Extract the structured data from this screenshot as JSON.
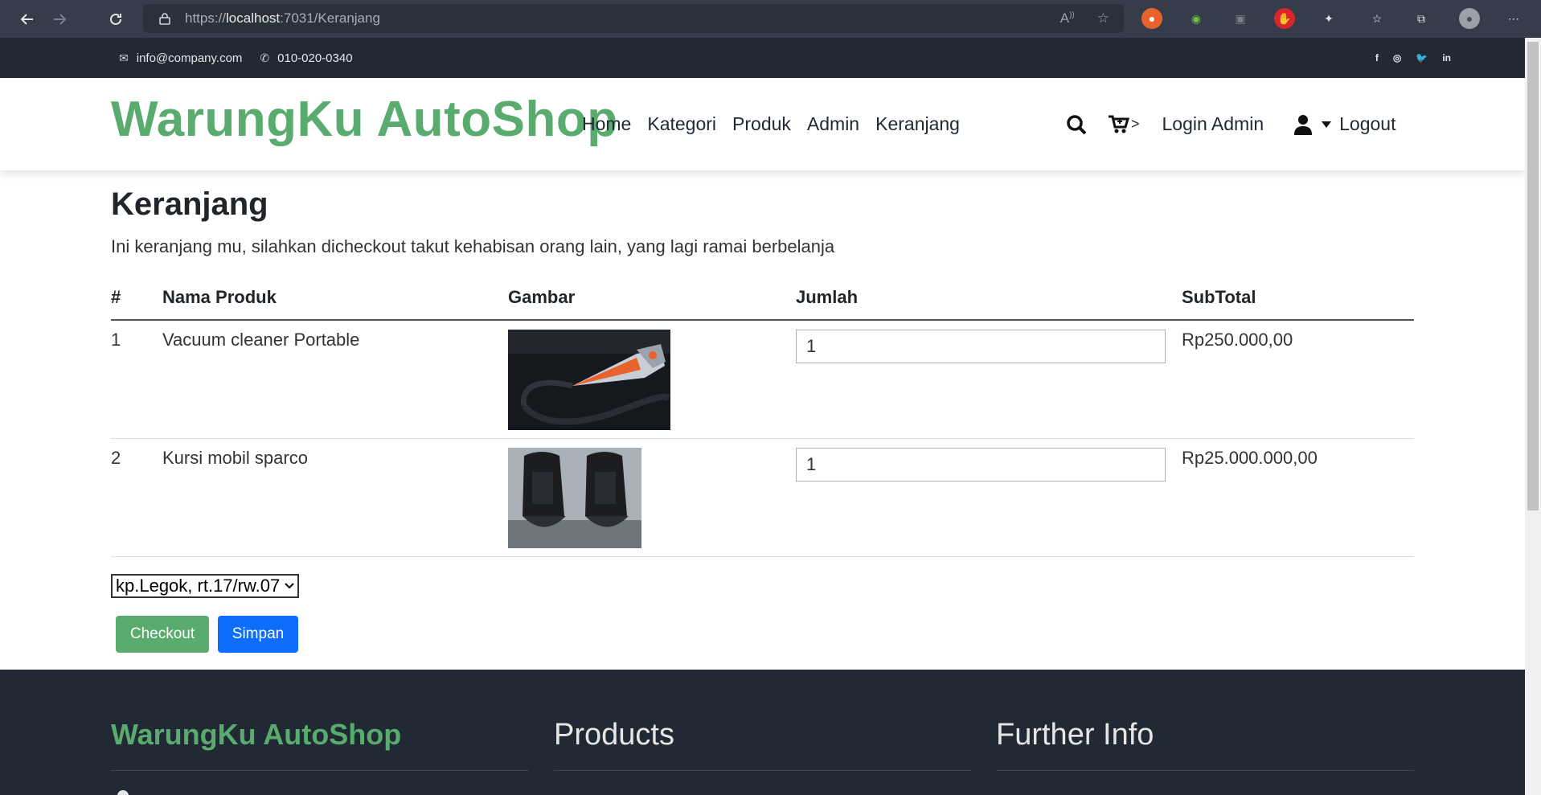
{
  "browser": {
    "url_prefix": "https://",
    "url_host": "localhost",
    "url_rest": ":7031/Keranjang"
  },
  "topbar": {
    "email": "info@company.com",
    "phone": "010-020-0340",
    "social": [
      "f",
      "◎",
      "🐦",
      "in"
    ]
  },
  "header": {
    "brand": "WarungKu AutoShop",
    "menu": [
      "Home",
      "Kategori",
      "Produk",
      "Admin",
      "Keranjang"
    ],
    "cart_suffix": ">",
    "login": "Login Admin",
    "logout": "Logout"
  },
  "page": {
    "title": "Keranjang",
    "description": "Ini keranjang mu, silahkan dicheckout takut kehabisan orang lain, yang lagi ramai berbelanja"
  },
  "table": {
    "headers": [
      "#",
      "Nama Produk",
      "Gambar",
      "Jumlah",
      "SubTotal"
    ],
    "rows": [
      {
        "no": "1",
        "name": "Vacuum cleaner Portable",
        "image": "vacuum-image",
        "qty": "1",
        "subtotal": "Rp250.000,00"
      },
      {
        "no": "2",
        "name": "Kursi mobil sparco",
        "image": "car-seats-image",
        "qty": "1",
        "subtotal": "Rp25.000.000,00"
      }
    ]
  },
  "form": {
    "address_selected": "kp.Legok, rt.17/rw.07",
    "checkout_label": "Checkout",
    "save_label": "Simpan"
  },
  "footer": {
    "brand": "WarungKu AutoShop",
    "col2": "Products",
    "col3": "Further Info"
  },
  "colors": {
    "brand_green": "#59ab6e",
    "dark": "#212934",
    "primary": "#0d6efd"
  }
}
